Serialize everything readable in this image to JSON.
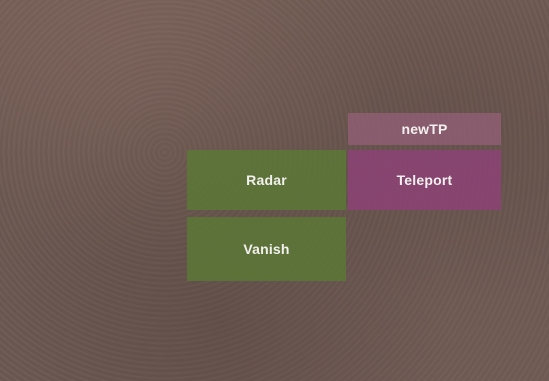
{
  "menu": {
    "buttons": {
      "newtp": {
        "label": "newTP",
        "color": "#966078"
      },
      "radar": {
        "label": "Radar",
        "color": "#5c7836"
      },
      "teleport": {
        "label": "Teleport",
        "color": "#8c4276"
      },
      "vanish": {
        "label": "Vanish",
        "color": "#5c7836"
      }
    }
  }
}
